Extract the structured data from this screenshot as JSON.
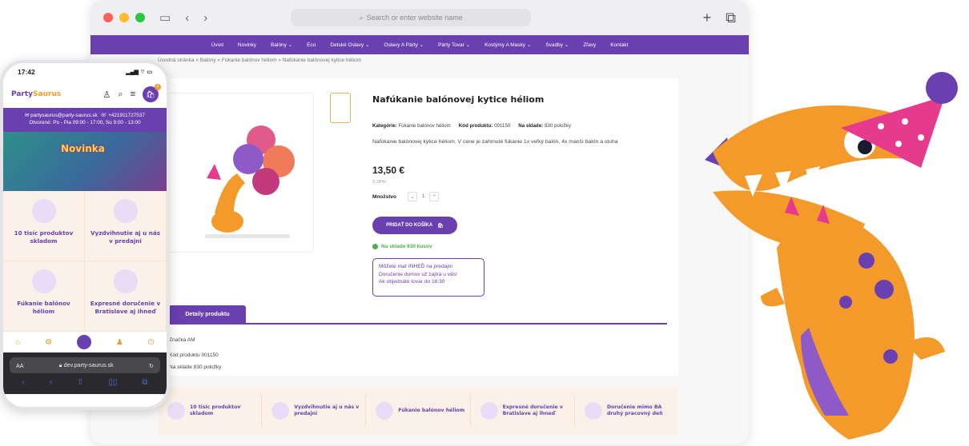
{
  "browser": {
    "address_placeholder": "Search or enter website name",
    "nav": [
      "Úvod",
      "Novinky",
      "Balóny ⌄",
      "Eco",
      "Detské Oslavy ⌄",
      "Oslavy A Párty ⌄",
      "Párty Tovar ⌄",
      "Kostýmy A Masky ⌄",
      "Svadby ⌄",
      "Zľavy",
      "Kontakt"
    ],
    "breadcrumb": "Úvodná stránka  »  Balóny  »  Fúkanie balónov héliom  »  Nafúkanie balónovej kytice héliom"
  },
  "product": {
    "title": "Nafúkanie balónovej kytice héliom",
    "category_label": "Kategórie:",
    "category_value": "Fúkanie balónov héliom",
    "code_label": "Kód produktu:",
    "code_value": "001150",
    "stock_label": "Na sklade:",
    "stock_value": "830 položky",
    "description": "Nafúkanie balónovej kytice héliom. V cene je zahrnuté fúkanie 1x veľký balón, 4x manší balón a stuha",
    "price": "13,50 €",
    "vat": "S DPH",
    "quantity_label": "Množstvo",
    "quantity": "1",
    "add_to_cart": "PRIDAŤ DO KOŠÍKA",
    "in_stock": "Na sklade 830 kusov",
    "pickup": [
      "Môžete mať INHEĎ na predajni",
      "Doručenie domov už zajtra u vás!",
      "Ak objednáte tovar do 16:30"
    ],
    "tab_details": "Detaily produktu",
    "spec_brand": "Značka AM",
    "spec_code": "Kód produktu 001150",
    "spec_stock": "Na sklade 830 položky"
  },
  "features": [
    "10 tisíc produktov skladom",
    "Vyzdvihnutie aj u nás v predajni",
    "Fúkanie balónov héliom",
    "Expresné doručenie v Bratislave aj ihneď",
    "Doručenie mimo BA druhý pracovný deň"
  ],
  "phone": {
    "time": "17:42",
    "signal": "▂▄▆ ⌔ ▭",
    "logo_a": "Party",
    "logo_b": "Saurus",
    "email": "partysaurus@party-saurus.sk",
    "phone": "+421911727537",
    "hours": "Otvorené: Po - Pia 09:00 - 17:00, So 9:00 - 13:00",
    "banner": "Novinka",
    "cart_count": "0",
    "tiles": [
      "10 tisíc produktov skladom",
      "Vyzdvihnutie aj u nás v predajni",
      "Fúkanie balónov héliom",
      "Expresné doručenie v Bratislave aj ihneď"
    ],
    "url_aa": "AA",
    "url": "dev.party-saurus.sk"
  },
  "colors": {
    "brand_purple": "#6a3fb0",
    "brand_orange": "#f39a2b",
    "pink_hat": "#e63a8e"
  }
}
